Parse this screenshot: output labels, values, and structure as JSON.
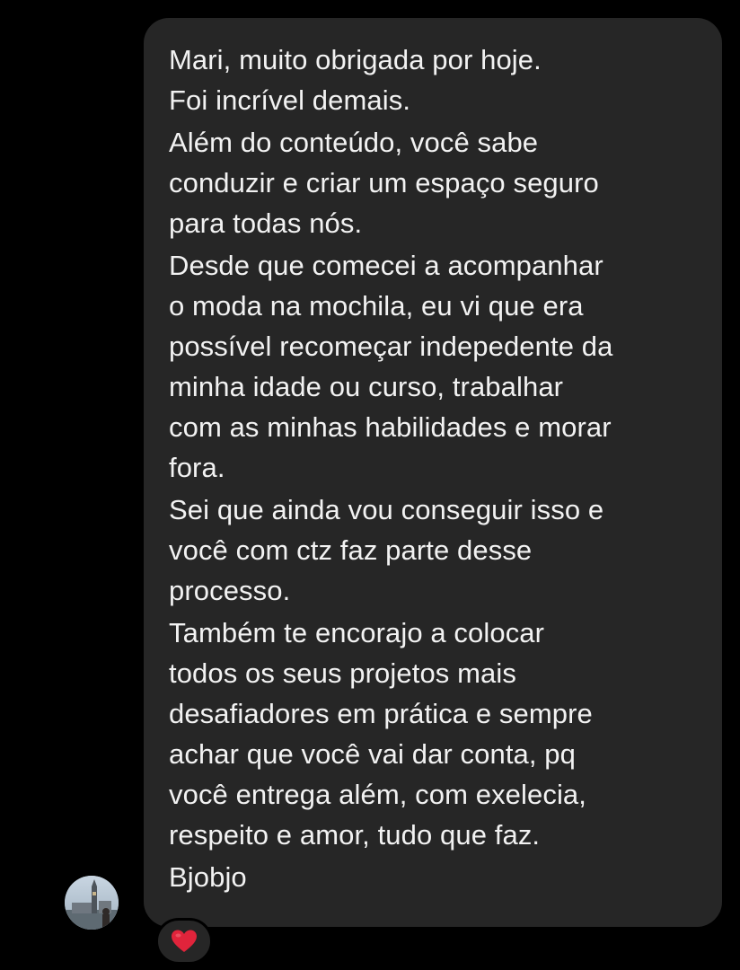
{
  "message": {
    "lines": [
      "Mari, muito obrigada por hoje.",
      "Foi incrível demais.",
      "Além do conteúdo, você sabe",
      "conduzir e criar um espaço seguro",
      "para todas nós.",
      "Desde que comecei a acompanhar",
      "o moda na mochila, eu vi que era",
      "possível recomeçar indepedente da",
      "minha idade ou curso, trabalhar",
      "com as minhas habilidades e morar",
      "fora.",
      "Sei que ainda vou conseguir isso e",
      "você com ctz faz parte desse",
      "processo.",
      "Também te encorajo a colocar",
      "todos os seus projetos mais",
      "desafiadores em prática e sempre",
      "achar que você vai dar conta, pq",
      "você entrega além, com exelecia,",
      "respeito e amor, tudo que faz.",
      "Bjobjo"
    ]
  },
  "reaction": {
    "emoji": "heart-icon",
    "color": "#e0243b"
  },
  "colors": {
    "background": "#000000",
    "bubble": "#262626",
    "text": "#f2f2f2"
  }
}
